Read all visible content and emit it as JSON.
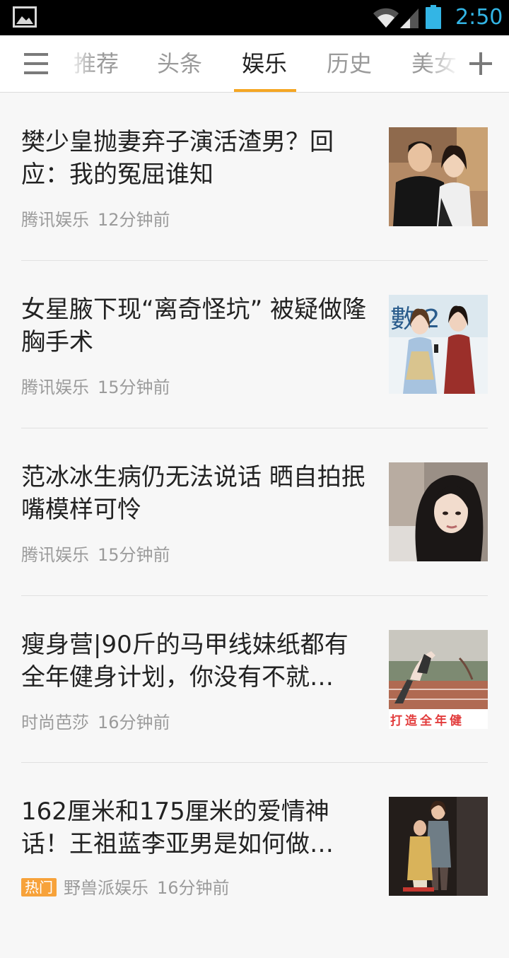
{
  "status_bar": {
    "time": "2:50",
    "icons": [
      "gallery-notification-icon",
      "wifi-icon",
      "cell-signal-icon",
      "battery-icon"
    ],
    "time_color": "#33b5e5"
  },
  "tabs": {
    "items": [
      {
        "label": "推荐",
        "active": false
      },
      {
        "label": "头条",
        "active": false
      },
      {
        "label": "娱乐",
        "active": true
      },
      {
        "label": "历史",
        "active": false
      },
      {
        "label": "美女",
        "active": false
      }
    ],
    "accent_color": "#f5a623",
    "menu_icon": "hamburger-menu-icon",
    "add_icon": "plus-icon"
  },
  "news": [
    {
      "title": "樊少皇抛妻弃子演活渣男？回应：我的冤屈谁知",
      "source": "腾讯娱乐",
      "time": "12分钟前",
      "hot": false,
      "thumb_caption": ""
    },
    {
      "title": "女星腋下现“离奇怪坑” 被疑做隆胸手术",
      "source": "腾讯娱乐",
      "time": "15分钟前",
      "hot": false,
      "thumb_caption": "數 2 1"
    },
    {
      "title": "范冰冰生病仍无法说话 晒自拍抿嘴模样可怜",
      "source": "腾讯娱乐",
      "time": "15分钟前",
      "hot": false,
      "thumb_caption": ""
    },
    {
      "title": "瘦身营|90斤的马甲线妹纸都有全年健身计划，你没有不就…",
      "source": "时尚芭莎",
      "time": "16分钟前",
      "hot": false,
      "thumb_caption": "打造全年健"
    },
    {
      "title": "162厘米和175厘米的爱情神话！王祖蓝李亚男是如何做…",
      "source": "野兽派娱乐",
      "time": "16分钟前",
      "hot": true,
      "hot_label": "热门",
      "thumb_caption": ""
    }
  ]
}
